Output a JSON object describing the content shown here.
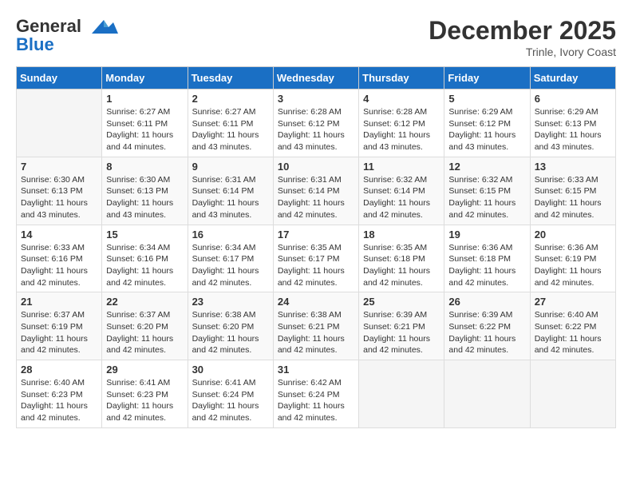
{
  "logo": {
    "line1": "General",
    "line2": "Blue"
  },
  "title": "December 2025",
  "location": "Trinle, Ivory Coast",
  "header": {
    "days": [
      "Sunday",
      "Monday",
      "Tuesday",
      "Wednesday",
      "Thursday",
      "Friday",
      "Saturday"
    ]
  },
  "weeks": [
    [
      {
        "day": "",
        "sunrise": "",
        "sunset": "",
        "daylight": ""
      },
      {
        "day": "1",
        "sunrise": "Sunrise: 6:27 AM",
        "sunset": "Sunset: 6:11 PM",
        "daylight": "Daylight: 11 hours and 44 minutes."
      },
      {
        "day": "2",
        "sunrise": "Sunrise: 6:27 AM",
        "sunset": "Sunset: 6:11 PM",
        "daylight": "Daylight: 11 hours and 43 minutes."
      },
      {
        "day": "3",
        "sunrise": "Sunrise: 6:28 AM",
        "sunset": "Sunset: 6:12 PM",
        "daylight": "Daylight: 11 hours and 43 minutes."
      },
      {
        "day": "4",
        "sunrise": "Sunrise: 6:28 AM",
        "sunset": "Sunset: 6:12 PM",
        "daylight": "Daylight: 11 hours and 43 minutes."
      },
      {
        "day": "5",
        "sunrise": "Sunrise: 6:29 AM",
        "sunset": "Sunset: 6:12 PM",
        "daylight": "Daylight: 11 hours and 43 minutes."
      },
      {
        "day": "6",
        "sunrise": "Sunrise: 6:29 AM",
        "sunset": "Sunset: 6:13 PM",
        "daylight": "Daylight: 11 hours and 43 minutes."
      }
    ],
    [
      {
        "day": "7",
        "sunrise": "Sunrise: 6:30 AM",
        "sunset": "Sunset: 6:13 PM",
        "daylight": "Daylight: 11 hours and 43 minutes."
      },
      {
        "day": "8",
        "sunrise": "Sunrise: 6:30 AM",
        "sunset": "Sunset: 6:13 PM",
        "daylight": "Daylight: 11 hours and 43 minutes."
      },
      {
        "day": "9",
        "sunrise": "Sunrise: 6:31 AM",
        "sunset": "Sunset: 6:14 PM",
        "daylight": "Daylight: 11 hours and 43 minutes."
      },
      {
        "day": "10",
        "sunrise": "Sunrise: 6:31 AM",
        "sunset": "Sunset: 6:14 PM",
        "daylight": "Daylight: 11 hours and 42 minutes."
      },
      {
        "day": "11",
        "sunrise": "Sunrise: 6:32 AM",
        "sunset": "Sunset: 6:14 PM",
        "daylight": "Daylight: 11 hours and 42 minutes."
      },
      {
        "day": "12",
        "sunrise": "Sunrise: 6:32 AM",
        "sunset": "Sunset: 6:15 PM",
        "daylight": "Daylight: 11 hours and 42 minutes."
      },
      {
        "day": "13",
        "sunrise": "Sunrise: 6:33 AM",
        "sunset": "Sunset: 6:15 PM",
        "daylight": "Daylight: 11 hours and 42 minutes."
      }
    ],
    [
      {
        "day": "14",
        "sunrise": "Sunrise: 6:33 AM",
        "sunset": "Sunset: 6:16 PM",
        "daylight": "Daylight: 11 hours and 42 minutes."
      },
      {
        "day": "15",
        "sunrise": "Sunrise: 6:34 AM",
        "sunset": "Sunset: 6:16 PM",
        "daylight": "Daylight: 11 hours and 42 minutes."
      },
      {
        "day": "16",
        "sunrise": "Sunrise: 6:34 AM",
        "sunset": "Sunset: 6:17 PM",
        "daylight": "Daylight: 11 hours and 42 minutes."
      },
      {
        "day": "17",
        "sunrise": "Sunrise: 6:35 AM",
        "sunset": "Sunset: 6:17 PM",
        "daylight": "Daylight: 11 hours and 42 minutes."
      },
      {
        "day": "18",
        "sunrise": "Sunrise: 6:35 AM",
        "sunset": "Sunset: 6:18 PM",
        "daylight": "Daylight: 11 hours and 42 minutes."
      },
      {
        "day": "19",
        "sunrise": "Sunrise: 6:36 AM",
        "sunset": "Sunset: 6:18 PM",
        "daylight": "Daylight: 11 hours and 42 minutes."
      },
      {
        "day": "20",
        "sunrise": "Sunrise: 6:36 AM",
        "sunset": "Sunset: 6:19 PM",
        "daylight": "Daylight: 11 hours and 42 minutes."
      }
    ],
    [
      {
        "day": "21",
        "sunrise": "Sunrise: 6:37 AM",
        "sunset": "Sunset: 6:19 PM",
        "daylight": "Daylight: 11 hours and 42 minutes."
      },
      {
        "day": "22",
        "sunrise": "Sunrise: 6:37 AM",
        "sunset": "Sunset: 6:20 PM",
        "daylight": "Daylight: 11 hours and 42 minutes."
      },
      {
        "day": "23",
        "sunrise": "Sunrise: 6:38 AM",
        "sunset": "Sunset: 6:20 PM",
        "daylight": "Daylight: 11 hours and 42 minutes."
      },
      {
        "day": "24",
        "sunrise": "Sunrise: 6:38 AM",
        "sunset": "Sunset: 6:21 PM",
        "daylight": "Daylight: 11 hours and 42 minutes."
      },
      {
        "day": "25",
        "sunrise": "Sunrise: 6:39 AM",
        "sunset": "Sunset: 6:21 PM",
        "daylight": "Daylight: 11 hours and 42 minutes."
      },
      {
        "day": "26",
        "sunrise": "Sunrise: 6:39 AM",
        "sunset": "Sunset: 6:22 PM",
        "daylight": "Daylight: 11 hours and 42 minutes."
      },
      {
        "day": "27",
        "sunrise": "Sunrise: 6:40 AM",
        "sunset": "Sunset: 6:22 PM",
        "daylight": "Daylight: 11 hours and 42 minutes."
      }
    ],
    [
      {
        "day": "28",
        "sunrise": "Sunrise: 6:40 AM",
        "sunset": "Sunset: 6:23 PM",
        "daylight": "Daylight: 11 hours and 42 minutes."
      },
      {
        "day": "29",
        "sunrise": "Sunrise: 6:41 AM",
        "sunset": "Sunset: 6:23 PM",
        "daylight": "Daylight: 11 hours and 42 minutes."
      },
      {
        "day": "30",
        "sunrise": "Sunrise: 6:41 AM",
        "sunset": "Sunset: 6:24 PM",
        "daylight": "Daylight: 11 hours and 42 minutes."
      },
      {
        "day": "31",
        "sunrise": "Sunrise: 6:42 AM",
        "sunset": "Sunset: 6:24 PM",
        "daylight": "Daylight: 11 hours and 42 minutes."
      },
      {
        "day": "",
        "sunrise": "",
        "sunset": "",
        "daylight": ""
      },
      {
        "day": "",
        "sunrise": "",
        "sunset": "",
        "daylight": ""
      },
      {
        "day": "",
        "sunrise": "",
        "sunset": "",
        "daylight": ""
      }
    ]
  ]
}
